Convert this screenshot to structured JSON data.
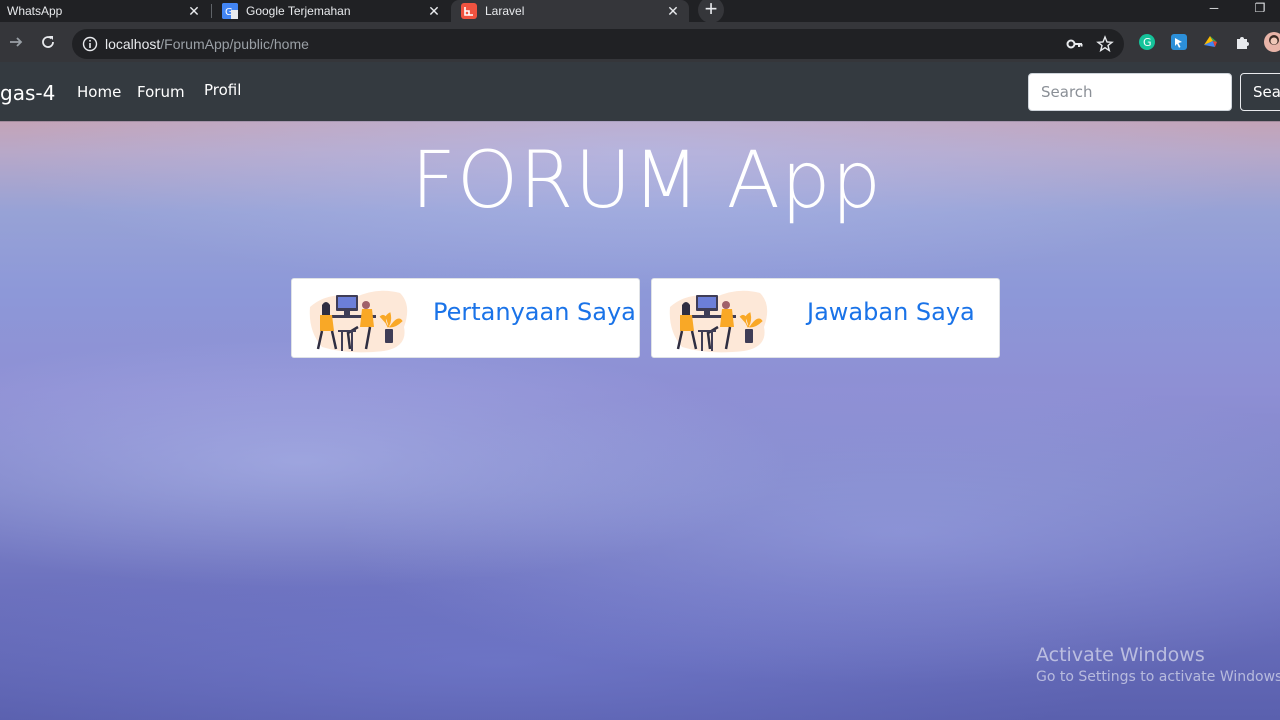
{
  "browser": {
    "tabs": [
      {
        "title": "WhatsApp",
        "icon": "whatsapp-icon",
        "active": false
      },
      {
        "title": "Google Terjemahan",
        "icon": "google-translate-icon",
        "active": false
      },
      {
        "title": "Laravel",
        "icon": "laravel-icon",
        "active": true
      }
    ],
    "url_host": "localhost",
    "url_path": "/ForumApp/public/home",
    "accent": "#1a73e8"
  },
  "navbar": {
    "brand": "gas-4",
    "links": [
      "Home",
      "Forum",
      "Profil"
    ],
    "search_placeholder": "Search",
    "search_button": "Sea"
  },
  "hero": {
    "title": "FORUM App"
  },
  "cards": [
    {
      "label": "Pertanyaan Saya",
      "icon": "people-at-desk-illustration"
    },
    {
      "label": "Jawaban Saya",
      "icon": "people-at-desk-illustration"
    }
  ],
  "watermark": {
    "line1": "Activate Windows",
    "line2": "Go to Settings to activate Windows."
  }
}
